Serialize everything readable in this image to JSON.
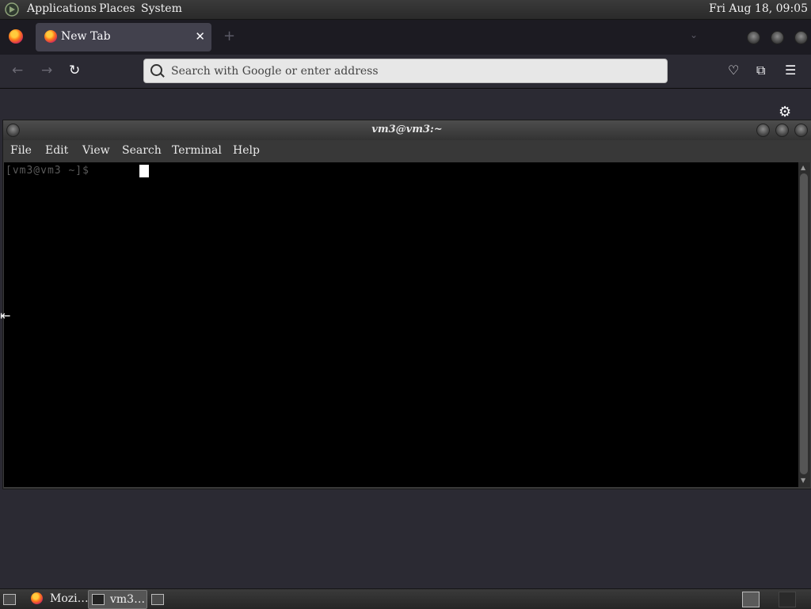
{
  "top_panel": {
    "menus": [
      "Applications",
      "Places",
      "System"
    ],
    "clock": "Fri Aug 18, 09:05"
  },
  "firefox": {
    "tab": {
      "title": "New Tab",
      "close": "✕"
    },
    "new_tab": "+",
    "url_placeholder": "Search with Google or enter address",
    "nav": {
      "back": "←",
      "forward": "→",
      "reload": "↻"
    },
    "tools": {
      "pocket": "♡",
      "extensions": "⧉",
      "menu": "☰"
    },
    "gear": "⚙"
  },
  "terminal": {
    "title": "vm3@vm3:~",
    "menu": [
      "File",
      "Edit",
      "View",
      "Search",
      "Terminal",
      "Help"
    ],
    "prompt": "[vm3@vm3 ~]$ "
  },
  "taskbar": {
    "items": [
      {
        "label": "Mozi…"
      },
      {
        "label": "vm3…"
      }
    ]
  }
}
